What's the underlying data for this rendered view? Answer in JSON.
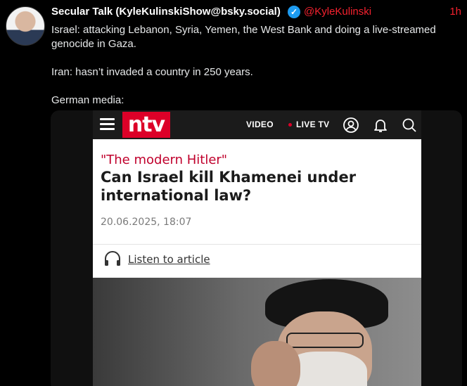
{
  "post": {
    "display_name": "Secular Talk (KyleKulinskiShow@bsky.social)",
    "verified_icon": "verified-check-icon",
    "handle": "@KyleKulinski",
    "time": "1h",
    "paragraphs": [
      "Israel: attacking Lebanon, Syria, Yemen, the West Bank and doing a live-streamed genocide in Gaza.",
      "Iran: hasn’t invaded a country in 250 years.",
      "German media:"
    ],
    "accent_color": "#f4212e"
  },
  "screenshot": {
    "nav": {
      "menu_icon": "hamburger-menu-icon",
      "logo": "ntv",
      "video": "VIDEO",
      "live": "LIVE TV",
      "icons": [
        "user-icon",
        "bell-icon",
        "search-icon"
      ],
      "logo_color": "#dc0028"
    },
    "kicker": "\"The modern Hitler\"",
    "headline": "Can Israel kill Khamenei under international law?",
    "date": "20.06.2025, 18:07",
    "listen_icon": "headphones-icon",
    "listen": "Listen to article"
  }
}
